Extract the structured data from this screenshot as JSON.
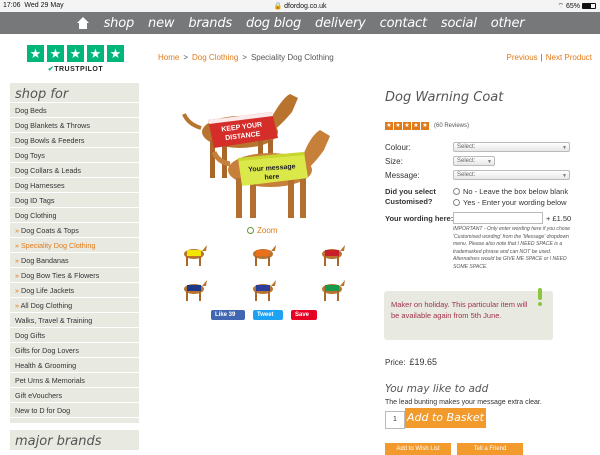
{
  "status": {
    "time": "17:06",
    "date": "Wed 29 May",
    "url": "dfordog.co.uk",
    "battery": "65%"
  },
  "nav": {
    "items": [
      "shop",
      "new",
      "brands",
      "dog blog",
      "delivery",
      "contact",
      "social",
      "other"
    ]
  },
  "trustpilot": {
    "brand": "TRUSTPILOT"
  },
  "breadcrumb": {
    "home": "Home",
    "category": "Dog Clothing",
    "current": "Speciality Dog Clothing"
  },
  "pager": {
    "previous": "Previous",
    "next": "Next Product"
  },
  "sidebar": {
    "heading": "shop for",
    "items": [
      {
        "label": "Dog Beds",
        "sub": false,
        "active": false
      },
      {
        "label": "Dog Blankets & Throws",
        "sub": false,
        "active": false
      },
      {
        "label": "Dog Bowls & Feeders",
        "sub": false,
        "active": false
      },
      {
        "label": "Dog Toys",
        "sub": false,
        "active": false
      },
      {
        "label": "Dog Collars & Leads",
        "sub": false,
        "active": false
      },
      {
        "label": "Dog Harnesses",
        "sub": false,
        "active": false
      },
      {
        "label": "Dog ID Tags",
        "sub": false,
        "active": false
      },
      {
        "label": "Dog Clothing",
        "sub": false,
        "active": false
      },
      {
        "label": "Dog Coats & Tops",
        "sub": true,
        "active": false
      },
      {
        "label": "Speciality Dog Clothing",
        "sub": true,
        "active": true
      },
      {
        "label": "Dog Bandanas",
        "sub": true,
        "active": false
      },
      {
        "label": "Dog Bow Ties & Flowers",
        "sub": true,
        "active": false
      },
      {
        "label": "Dog Life Jackets",
        "sub": true,
        "active": false
      },
      {
        "label": "All Dog Clothing",
        "sub": true,
        "active": false
      },
      {
        "label": "Walks, Travel & Training",
        "sub": false,
        "active": false
      },
      {
        "label": "Dog Gifts",
        "sub": false,
        "active": false
      },
      {
        "label": "Gifts for Dog Lovers",
        "sub": false,
        "active": false
      },
      {
        "label": "Health & Grooming",
        "sub": false,
        "active": false
      },
      {
        "label": "Pet Urns & Memorials",
        "sub": false,
        "active": false
      },
      {
        "label": "Gift eVouchers",
        "sub": false,
        "active": false
      },
      {
        "label": "New to D for Dog",
        "sub": false,
        "active": false
      }
    ],
    "heading2": "major brands"
  },
  "product": {
    "coat_red_text": "KEEP YOUR DISTANCE",
    "coat_yellow_text": "Your message here",
    "zoom": "Zoom",
    "thumb_colors": [
      "#f2e600",
      "#e8701a",
      "#c8202a",
      "#1d3a8a",
      "#2b3f9a",
      "#1a9a4a"
    ],
    "social": {
      "like": "Like 39",
      "tweet": "Tweet",
      "save": "Save"
    },
    "title": "Dog Warning Coat",
    "reviews": "(60 Reviews)",
    "colour_label": "Colour:",
    "size_label": "Size:",
    "message_label": "Message:",
    "select_placeholder": "Select:",
    "customised_label": "Did you select Customised?",
    "radio_no": "No - Leave the box below blank",
    "radio_yes": "Yes - Enter your wording below",
    "wording_label": "Your wording here:",
    "wording_price": "+ £1.50",
    "important": "IMPORTANT - Only enter wording here if you chose 'Customised wording' from the 'Message' dropdown menu. Please also note that I NEED SPACE is a trademarked phrase and can NOT be used. Alternatives would be GIVE ME SPACE or I NEED SOME SPACE.",
    "notice": "Maker on holiday. This particular item will be available again from 5th June.",
    "price_label": "Price:",
    "price": "£19.65",
    "may_like": "You may like to add",
    "may_like_sub": "The lead bunting makes your message extra clear.",
    "qty": "1",
    "add_to_basket": "Add to Basket",
    "add_to_wishlist": "Add to Wish List",
    "tell_a_friend": "Tell a Friend"
  }
}
